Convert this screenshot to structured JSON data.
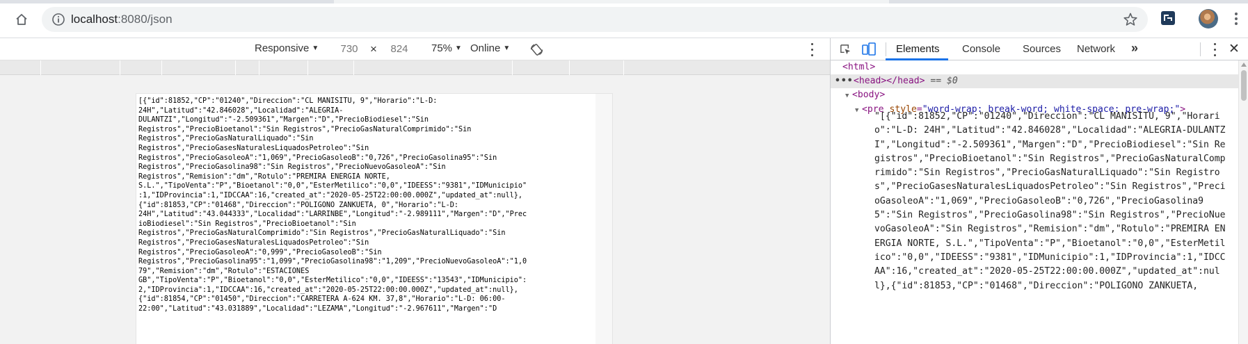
{
  "browser": {
    "url_host": "localhost",
    "url_rest": ":8080/json",
    "icons": {
      "home": "home-icon",
      "info": "info-icon",
      "star": "star-icon",
      "extension": "extension-icon",
      "menu": "more-vertical-icon"
    }
  },
  "device_toolbar": {
    "device": "Responsive",
    "width": "730",
    "x": "×",
    "height": "824",
    "zoom": "75%",
    "throttle": "Online"
  },
  "page": {
    "json": "[{\"id\":81852,\"CP\":\"01240\",\"Direccion\":\"CL MANISITU, 9\",\"Horario\":\"L-D: 24H\",\"Latitud\":\"42.846028\",\"Localidad\":\"ALEGRIA-DULANTZI\",\"Longitud\":\"-2.509361\",\"Margen\":\"D\",\"PrecioBiodiesel\":\"Sin Registros\",\"PrecioBioetanol\":\"Sin Registros\",\"PrecioGasNaturalComprimido\":\"Sin Registros\",\"PrecioGasNaturalLiquado\":\"Sin Registros\",\"PrecioGasesNaturalesLiquadosPetroleo\":\"Sin Registros\",\"PrecioGasoleoA\":\"1,069\",\"PrecioGasoleoB\":\"0,726\",\"PrecioGasolina95\":\"Sin Registros\",\"PrecioGasolina98\":\"Sin Registros\",\"PrecioNuevoGasoleoA\":\"Sin Registros\",\"Remision\":\"dm\",\"Rotulo\":\"PREMIRA ENERGIA NORTE, S.L.\",\"TipoVenta\":\"P\",\"Bioetanol\":\"0,0\",\"EsterMetilico\":\"0,0\",\"IDEESS\":\"9381\",\"IDMunicipio\":1,\"IDProvincia\":1,\"IDCCAA\":16,\"created_at\":\"2020-05-25T22:00:00.000Z\",\"updated_at\":null},{\"id\":81853,\"CP\":\"01468\",\"Direccion\":\"POLIGONO ZANKUETA, 0\",\"Horario\":\"L-D: 24H\",\"Latitud\":\"43.044333\",\"Localidad\":\"LARRINBE\",\"Longitud\":\"-2.989111\",\"Margen\":\"D\",\"PrecioBiodiesel\":\"Sin Registros\",\"PrecioBioetanol\":\"Sin Registros\",\"PrecioGasNaturalComprimido\":\"Sin Registros\",\"PrecioGasNaturalLiquado\":\"Sin Registros\",\"PrecioGasesNaturalesLiquadosPetroleo\":\"Sin Registros\",\"PrecioGasoleoA\":\"0,999\",\"PrecioGasoleoB\":\"Sin Registros\",\"PrecioGasolina95\":\"1,099\",\"PrecioGasolina98\":\"1,209\",\"PrecioNuevoGasoleoA\":\"1,079\",\"Remision\":\"dm\",\"Rotulo\":\"ESTACIONES GB\",\"TipoVenta\":\"P\",\"Bioetanol\":\"0,0\",\"EsterMetilico\":\"0,0\",\"IDEESS\":\"13543\",\"IDMunicipio\":2,\"IDProvincia\":1,\"IDCCAA\":16,\"created_at\":\"2020-05-25T22:00:00.000Z\",\"updated_at\":null},{\"id\":81854,\"CP\":\"01450\",\"Direccion\":\"CARRETERA A-624 KM. 37,8\",\"Horario\":\"L-D: 06:00-22:00\",\"Latitud\":\"43.031889\",\"Localidad\":\"LEZAMA\",\"Longitud\":\"-2.967611\",\"Margen\":\"D"
  },
  "devtools": {
    "tabs": [
      "Elements",
      "Console",
      "Sources",
      "Network"
    ],
    "more_tabs": "»",
    "tree": {
      "html_open": "<html>",
      "head": "<head></head>",
      "head_eq": "== $0",
      "body_open": "<body>",
      "pre_tag": "<pre",
      "pre_attr_name": "style",
      "pre_attr_value": "\"word-wrap: break-word; white-space: pre-wrap;\"",
      "pre_close": ">"
    },
    "json_text": "\"[{\"id\":81852,\"CP\":\"01240\",\"Direccion\":\"CL MANISITU, 9\",\"Horario\":\"L-D: 24H\",\"Latitud\":\"42.846028\",\"Localidad\":\"ALEGRIA-DULANTZI\",\"Longitud\":\"-2.509361\",\"Margen\":\"D\",\"PrecioBiodiesel\":\"Sin Registros\",\"PrecioBioetanol\":\"Sin Registros\",\"PrecioGasNaturalComprimido\":\"Sin Registros\",\"PrecioGasNaturalLiquado\":\"Sin Registros\",\"PrecioGasesNaturalesLiquadosPetroleo\":\"Sin Registros\",\"PrecioGasoleoA\":\"1,069\",\"PrecioGasoleoB\":\"0,726\",\"PrecioGasolina95\":\"Sin Registros\",\"PrecioGasolina98\":\"Sin Registros\",\"PrecioNuevoGasoleoA\":\"Sin Registros\",\"Remision\":\"dm\",\"Rotulo\":\"PREMIRA ENERGIA NORTE, S.L.\",\"TipoVenta\":\"P\",\"Bioetanol\":\"0,0\",\"EsterMetilico\":\"0,0\",\"IDEESS\":\"9381\",\"IDMunicipio\":1,\"IDProvincia\":1,\"IDCCAA\":16,\"created_at\":\"2020-05-25T22:00:00.000Z\",\"updated_at\":null},{\"id\":81853,\"CP\":\"01468\",\"Direccion\":\"POLIGONO ZANKUETA,"
  },
  "colors": {
    "accent": "#1a73e8",
    "tag": "#881280",
    "attr_name": "#994500",
    "attr_value": "#1a1aa6"
  }
}
